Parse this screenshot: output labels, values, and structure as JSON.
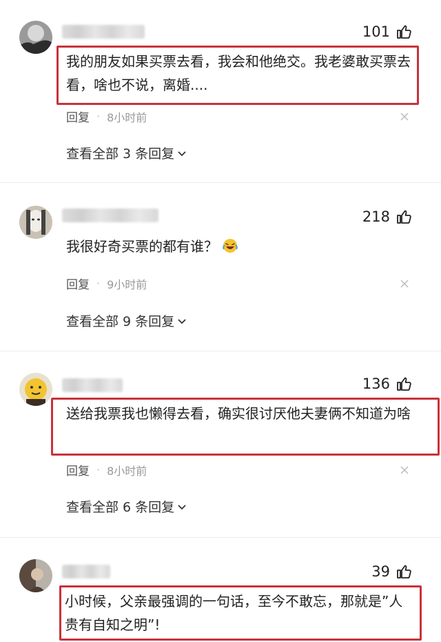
{
  "comments": [
    {
      "likes": "101",
      "text": "我的朋友如果买票去看，我会和他绝交。我老婆敢买票去看，啥也不说，离婚....",
      "reply_label": "回复",
      "time": "8小时前",
      "view_replies": "查看全部 3 条回复"
    },
    {
      "likes": "218",
      "text": "我很好奇买票的都有谁？",
      "emoji": "laughing-crying-emoji",
      "reply_label": "回复",
      "time": "9小时前",
      "view_replies": "查看全部 9 条回复"
    },
    {
      "likes": "136",
      "text": "送给我票我也懒得去看，确实很讨厌他夫妻俩不知道为啥",
      "reply_label": "回复",
      "time": "8小时前",
      "view_replies": "查看全部 6 条回复"
    },
    {
      "likes": "39",
      "text": "小时候，父亲最强调的一句话，至今不敢忘，那就是”人贵有自知之明”!"
    }
  ],
  "colors": {
    "highlight_border": "#c8323a",
    "meta_text": "#999999",
    "primary_text": "#222222"
  }
}
